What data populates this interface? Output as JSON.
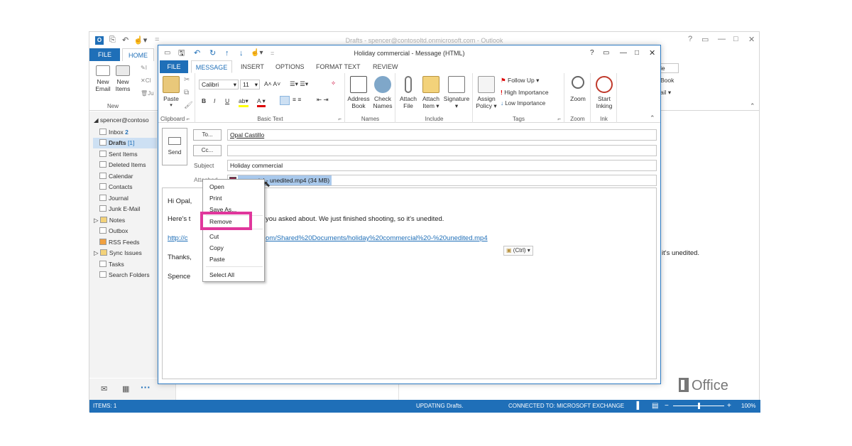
{
  "main_window": {
    "title": "Drafts - spencer@contosoltd.onmicrosoft.com - Outlook",
    "window_controls": [
      "?",
      "▭",
      "—",
      "□",
      "✕"
    ],
    "tabs": [
      "FILE",
      "HOME"
    ],
    "ribbon": {
      "new_email": "New\nEmail",
      "new_items": "New\nItems",
      "group_new": "New",
      "right_fragments": [
        "le",
        "Book",
        "ail ▾"
      ]
    },
    "account": "spencer@contoso",
    "folders": [
      {
        "name": "Inbox",
        "count": "2"
      },
      {
        "name": "Drafts",
        "count": "[1]"
      },
      {
        "name": "Sent Items",
        "count": ""
      },
      {
        "name": "Deleted Items",
        "count": ""
      },
      {
        "name": "Calendar",
        "count": ""
      },
      {
        "name": "Contacts",
        "count": ""
      },
      {
        "name": "Journal",
        "count": ""
      },
      {
        "name": "Junk E-Mail",
        "count": ""
      },
      {
        "name": "Notes",
        "count": ""
      },
      {
        "name": "Outbox",
        "count": ""
      },
      {
        "name": "RSS Feeds",
        "count": ""
      },
      {
        "name": "Sync Issues",
        "count": ""
      },
      {
        "name": "Tasks",
        "count": ""
      },
      {
        "name": "Search Folders",
        "count": ""
      }
    ],
    "reading_pane_text": "it's unedited.",
    "nav_icons": [
      "mail-icon",
      "calendar-icon",
      "more-icon"
    ],
    "status": {
      "items": "ITEMS: 1",
      "updating": "UPDATING Drafts.",
      "connected": "CONNECTED TO: MICROSOFT EXCHANGE",
      "zoom": "100%"
    }
  },
  "message_window": {
    "title": "Holiday commercial - Message (HTML)",
    "controls": [
      "?",
      "▭",
      "—",
      "□",
      "✕"
    ],
    "tabs": [
      "FILE",
      "MESSAGE",
      "INSERT",
      "OPTIONS",
      "FORMAT TEXT",
      "REVIEW"
    ],
    "active_tab": "MESSAGE",
    "ribbon": {
      "clipboard": {
        "paste": "Paste",
        "label": "Clipboard"
      },
      "basic_text": {
        "font": "Calibri",
        "size": "11",
        "label": "Basic Text"
      },
      "names": {
        "address_book": "Address\nBook",
        "check_names": "Check\nNames",
        "label": "Names"
      },
      "include": {
        "attach_file": "Attach\nFile",
        "attach_item": "Attach\nItem ▾",
        "signature": "Signature\n▾",
        "label": "Include"
      },
      "tags": {
        "assign_policy": "Assign\nPolicy ▾",
        "follow_up": "Follow Up ▾",
        "high_importance": "High Importance",
        "low_importance": "Low Importance",
        "label": "Tags"
      },
      "zoom": {
        "zoom": "Zoom",
        "label": "Zoom"
      },
      "ink": {
        "start_inking": "Start\nInking",
        "label": "Ink"
      }
    },
    "send": "Send",
    "to_button": "To...",
    "cc_button": "Cc...",
    "to_value": "Opal Castillo",
    "cc_value": "",
    "subject_label": "Subject",
    "subject_value": "Holiday commercial",
    "attached_label": "Attached",
    "attachment": "mmercial - unedited.mp4 (34 MB)",
    "body": {
      "greeting": "Hi Opal,",
      "line1_start": "Here's t",
      "line1_end": "you asked about. We just finished shooting, so it's unedited.",
      "link_start": "http://c",
      "link_end": "om/Shared%20Documents/holiday%20commercial%20-%20unedited.mp4",
      "thanks": "Thanks,",
      "signature": "Spence",
      "paste_options": "(Ctrl) ▾"
    }
  },
  "context_menu": {
    "items": [
      "Open",
      "Print",
      "Save As...",
      "Remove",
      "Cut",
      "Copy",
      "Paste",
      "Select All"
    ],
    "highlighted": "Remove"
  },
  "office_logo": "Office"
}
